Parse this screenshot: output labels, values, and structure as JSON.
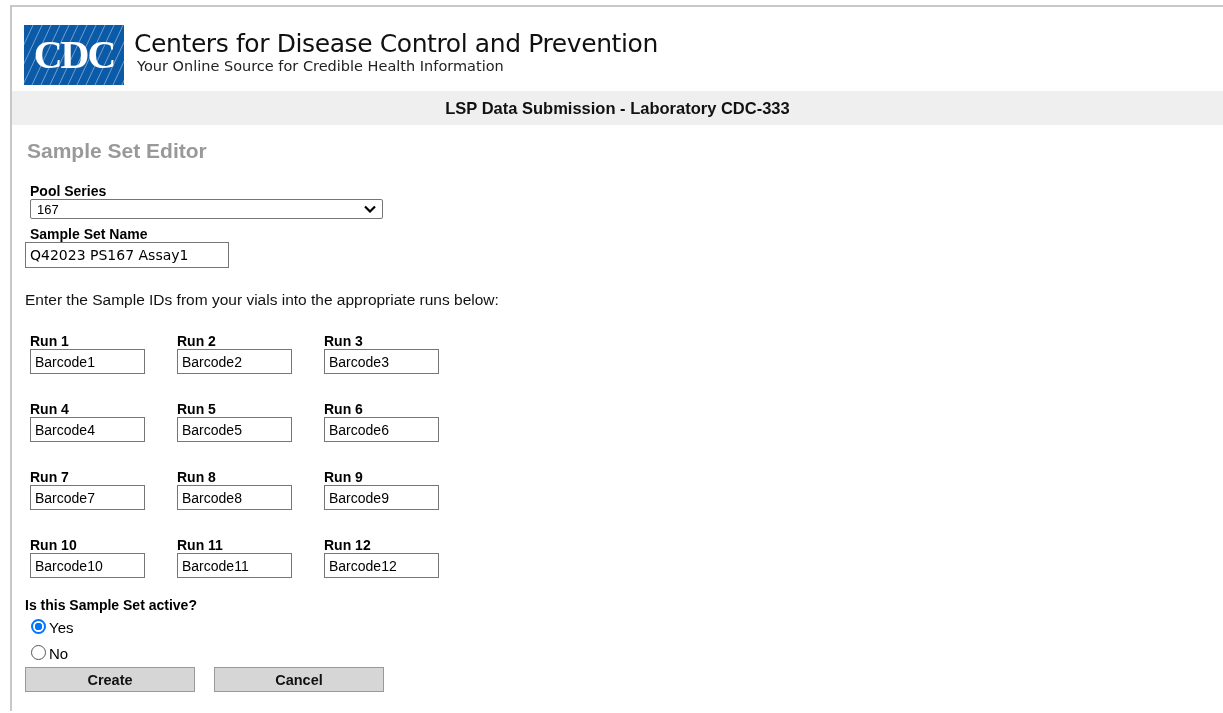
{
  "header": {
    "logo_text": "CDC",
    "title": "Centers for Disease Control and Prevention",
    "tagline": "Your Online Source for Credible Health Information"
  },
  "banner": "LSP Data Submission - Laboratory CDC-333",
  "heading": "Sample Set Editor",
  "pool_series": {
    "label": "Pool Series",
    "value": "167"
  },
  "sample_set_name": {
    "label": "Sample Set Name",
    "value": "Q42023 PS167 Assay1"
  },
  "instruction": "Enter the Sample IDs from your vials into the appropriate runs below:",
  "runs": [
    {
      "label": "Run 1",
      "value": "Barcode1"
    },
    {
      "label": "Run 2",
      "value": "Barcode2"
    },
    {
      "label": "Run 3",
      "value": "Barcode3"
    },
    {
      "label": "Run 4",
      "value": "Barcode4"
    },
    {
      "label": "Run 5",
      "value": "Barcode5"
    },
    {
      "label": "Run 6",
      "value": "Barcode6"
    },
    {
      "label": "Run 7",
      "value": "Barcode7"
    },
    {
      "label": "Run 8",
      "value": "Barcode8"
    },
    {
      "label": "Run 9",
      "value": "Barcode9"
    },
    {
      "label": "Run 10",
      "value": "Barcode10"
    },
    {
      "label": "Run 11",
      "value": "Barcode11"
    },
    {
      "label": "Run 12",
      "value": "Barcode12"
    }
  ],
  "active": {
    "question": "Is this Sample Set active?",
    "options": [
      {
        "label": "Yes",
        "selected": true
      },
      {
        "label": "No",
        "selected": false
      }
    ]
  },
  "buttons": [
    "Create",
    "Cancel"
  ]
}
